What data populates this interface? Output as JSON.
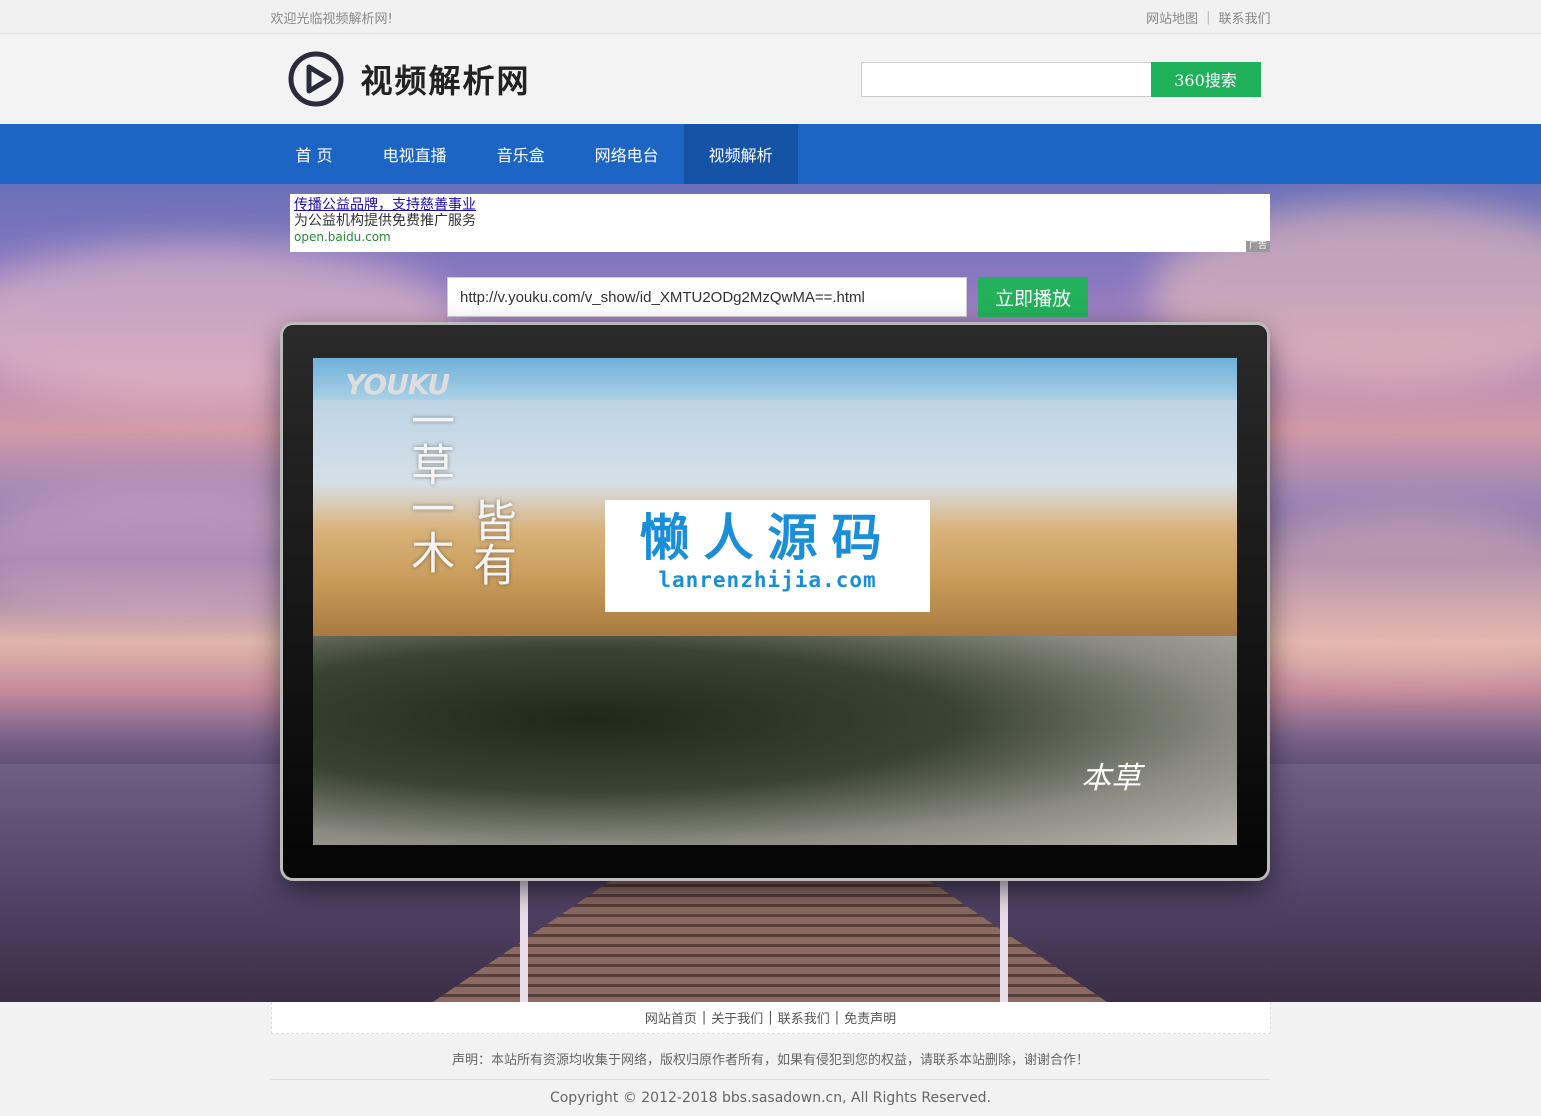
{
  "topbar": {
    "welcome": "欢迎光临视频解析网!",
    "links": [
      "网站地图",
      "联系我们"
    ],
    "separator": "|"
  },
  "header": {
    "logo_text": "视频解析网",
    "logo_icon": "play-circle-icon",
    "search": {
      "value": "",
      "placeholder": "",
      "button": "360搜索"
    }
  },
  "nav": {
    "items": [
      "首 页",
      "电视直播",
      "音乐盒",
      "网络电台",
      "视频解析"
    ],
    "active_index": 4,
    "color": "#1c65c5",
    "active_color": "#1553a6"
  },
  "ad": {
    "title": "传播公益品牌，支持慈善事业",
    "desc": "为公益机构提供免费推广服务",
    "url": "open.baidu.com",
    "tag": "广告"
  },
  "parse": {
    "url_value": "http://v.youku.com/v_show/id_XMTU2ODg2MzQwMA==.html",
    "button": "立即播放",
    "button_color": "#24b15b"
  },
  "video": {
    "brand": "YOUKU",
    "text_col1": "一草一木",
    "text_col2": "皆有",
    "corner_mark": "本草",
    "watermark_cn": "懒人源码",
    "watermark_en": "lanrenzhijia.com"
  },
  "footer": {
    "links": [
      "网站首页",
      "关于我们",
      "联系我们",
      "免责声明"
    ],
    "separator": "|",
    "notice": "声明：本站所有资源均收集于网络，版权归原作者所有，如果有侵犯到您的权益，请联系本站删除，谢谢合作！",
    "copyright": "Copyright © 2012-2018 bbs.sasadown.cn, All Rights Reserved."
  }
}
